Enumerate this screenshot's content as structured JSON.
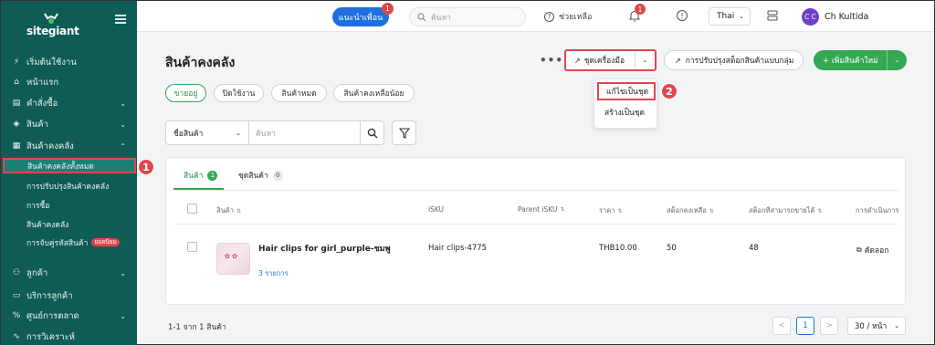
{
  "brand": {
    "name": "sitegiant"
  },
  "sidebar": {
    "items": [
      {
        "label": "เริ่มต้นใช้งาน",
        "icon": "lightning-icon"
      },
      {
        "label": "หน้าแรก",
        "icon": "home-icon"
      },
      {
        "label": "คำสั่งซื้อ",
        "icon": "orders-icon"
      },
      {
        "label": "สินค้า",
        "icon": "box-icon"
      },
      {
        "label": "สินค้าคงคลัง",
        "icon": "inventory-icon"
      },
      {
        "label": "ลูกค้า",
        "icon": "users-icon"
      },
      {
        "label": "บริการลูกค้า",
        "icon": "chat-icon"
      },
      {
        "label": "ศูนย์การตลาด",
        "icon": "percent-icon"
      },
      {
        "label": "การวิเคราะห์",
        "icon": "analytics-icon"
      }
    ],
    "inventory_sub": [
      {
        "label": "สินค้าคงคลังทั้งหมด"
      },
      {
        "label": "การปรับปรุงสินค้าคงคลัง"
      },
      {
        "label": "การซื้อ"
      },
      {
        "label": "สินค้าคงคลัง"
      },
      {
        "label": "การจับคู่รหัสสินค้า",
        "badge": "ยอดนิยม"
      }
    ],
    "callout_1": "1"
  },
  "topbar": {
    "invite_label": "แนะนำเพื่อน",
    "invite_badge": "1",
    "search_placeholder": "ค้นหา",
    "help_label": "ช่วยเหลือ",
    "notif_badge": "1",
    "language": "Thai",
    "avatar_initials": "C C",
    "username": "Ch Kultida"
  },
  "page": {
    "title": "สินค้าคงคลัง",
    "filter_tabs": [
      "ขายอยู่",
      "ปิดใช้งาน",
      "สินค้าหมด",
      "สินค้าคงเหลือน้อย"
    ],
    "more_label": "•••",
    "tools_label": "ชุดเครื่องมือ",
    "bulk_label": "การปรับปรุงสต็อกสินค้าแบบกลุ่ม",
    "add_label": "+ เพิ่มสินค้าใหม่",
    "dropdown": [
      "แก้ไขเป็นชุด",
      "สร้างเป็นชุด"
    ],
    "callout_2": "2"
  },
  "search": {
    "field": "ชื่อสินค้า",
    "placeholder": "ค้นหา"
  },
  "content_tabs": [
    {
      "label": "สินค้า",
      "count": "1"
    },
    {
      "label": "ชุดสินค้า",
      "count": "0"
    }
  ],
  "table": {
    "columns": [
      "สินค้า",
      "iSKU",
      "Parent iSKU",
      "ราคา",
      "สต็อกคงเหลือ",
      "สต็อกที่สามารถขายได้",
      "การดำเนินการ"
    ],
    "rows": [
      {
        "name": "Hair clips for girl_purple-ชมพู",
        "variants": "3 รายการ",
        "isku": "Hair clips-4775",
        "parent_isku": "",
        "price": "THB10.00",
        "stock": "50",
        "sellable": "48",
        "action": "คัดลอก"
      }
    ]
  },
  "footer": {
    "count_text": "1-1 จาก 1 สินค้า",
    "prev": "<",
    "page": "1",
    "next": ">",
    "per_page": "30 / หน้า"
  },
  "colors": {
    "sidebar_bg": "#0e5c55",
    "accent_green": "#34a853",
    "highlight_red": "#e0474c",
    "primary_blue": "#1f6fe0"
  }
}
